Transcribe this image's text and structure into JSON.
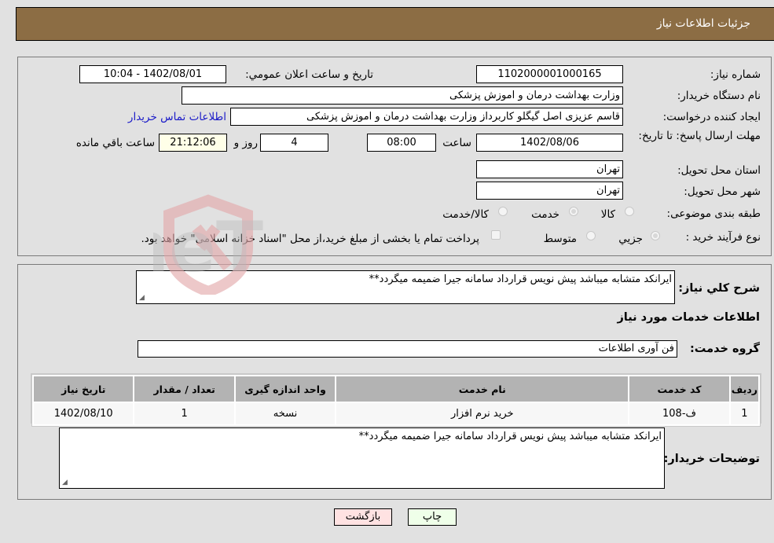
{
  "header": {
    "title": "جزئیات اطلاعات نیاز"
  },
  "details": {
    "need_number_label": "شماره نیاز:",
    "need_number": "1102000001000165",
    "announce_label": "تاریخ و ساعت اعلان عمومي:",
    "announce_value": "1402/08/01 - 10:04",
    "buyer_org_label": "نام دستگاه خریدار:",
    "buyer_org": "وزارت بهداشت  درمان و اموزش پزشکی",
    "creator_label": "ایجاد کننده درخواست:",
    "creator": "قاسم عزیزی اصل گیگلو کاربرداز وزارت بهداشت  درمان و اموزش پزشکی",
    "buyer_contact_link": "اطلاعات تماس خریدار",
    "deadline_label": "مهلت ارسال پاسخ: تا تاریخ:",
    "deadline_date": "1402/08/06",
    "time_label": "ساعت",
    "deadline_time": "08:00",
    "days_value": "4",
    "days_label": "روز و",
    "remaining_time": "21:12:06",
    "remaining_label": "ساعت باقي مانده",
    "province_label": "استان محل تحویل:",
    "province": "تهران",
    "city_label": "شهر محل تحویل:",
    "city": "تهران",
    "category_label": "طبقه بندی موضوعی:",
    "category_options": [
      {
        "label": "کالا",
        "selected": false
      },
      {
        "label": "خدمت",
        "selected": true
      },
      {
        "label": "کالا/خدمت",
        "selected": false
      }
    ],
    "process_label": "نوع فرآیند خرید :",
    "process_options": [
      {
        "label": "جزيي",
        "selected": true
      },
      {
        "label": "متوسط",
        "selected": false
      }
    ],
    "treasury_note": "پرداخت تمام یا بخشی از مبلغ خرید،از محل \"اسناد خزانه اسلامی\" خواهد بود.",
    "treasury_checked": false
  },
  "services": {
    "description_label": "شرح کلي نیاز:",
    "description": "ایرانکد متشابه میباشد پیش نویس قرارداد سامانه جیرا ضمیمه میگردد**",
    "section_title": "اطلاعات خدمات مورد نیاز",
    "group_label": "گروه خدمت:",
    "group_value": "فن آوری اطلاعات",
    "table": {
      "headers": [
        "ردیف",
        "کد خدمت",
        "نام خدمت",
        "واحد اندازه گیری",
        "تعداد / مقدار",
        "تاریخ نیاز"
      ],
      "rows": [
        [
          "1",
          "ف-108",
          "خرید نرم افزار",
          "نسخه",
          "1",
          "1402/08/10"
        ]
      ]
    },
    "buyer_notes_label": "توضیحات خریدار:",
    "buyer_notes": "ایرانکد متشابه میباشد پیش نویس قرارداد سامانه جیرا ضمیمه میگردد**"
  },
  "actions": {
    "print_label": "چاپ",
    "back_label": "بازگشت"
  },
  "watermark": {
    "text": "AriaTender.neT"
  }
}
